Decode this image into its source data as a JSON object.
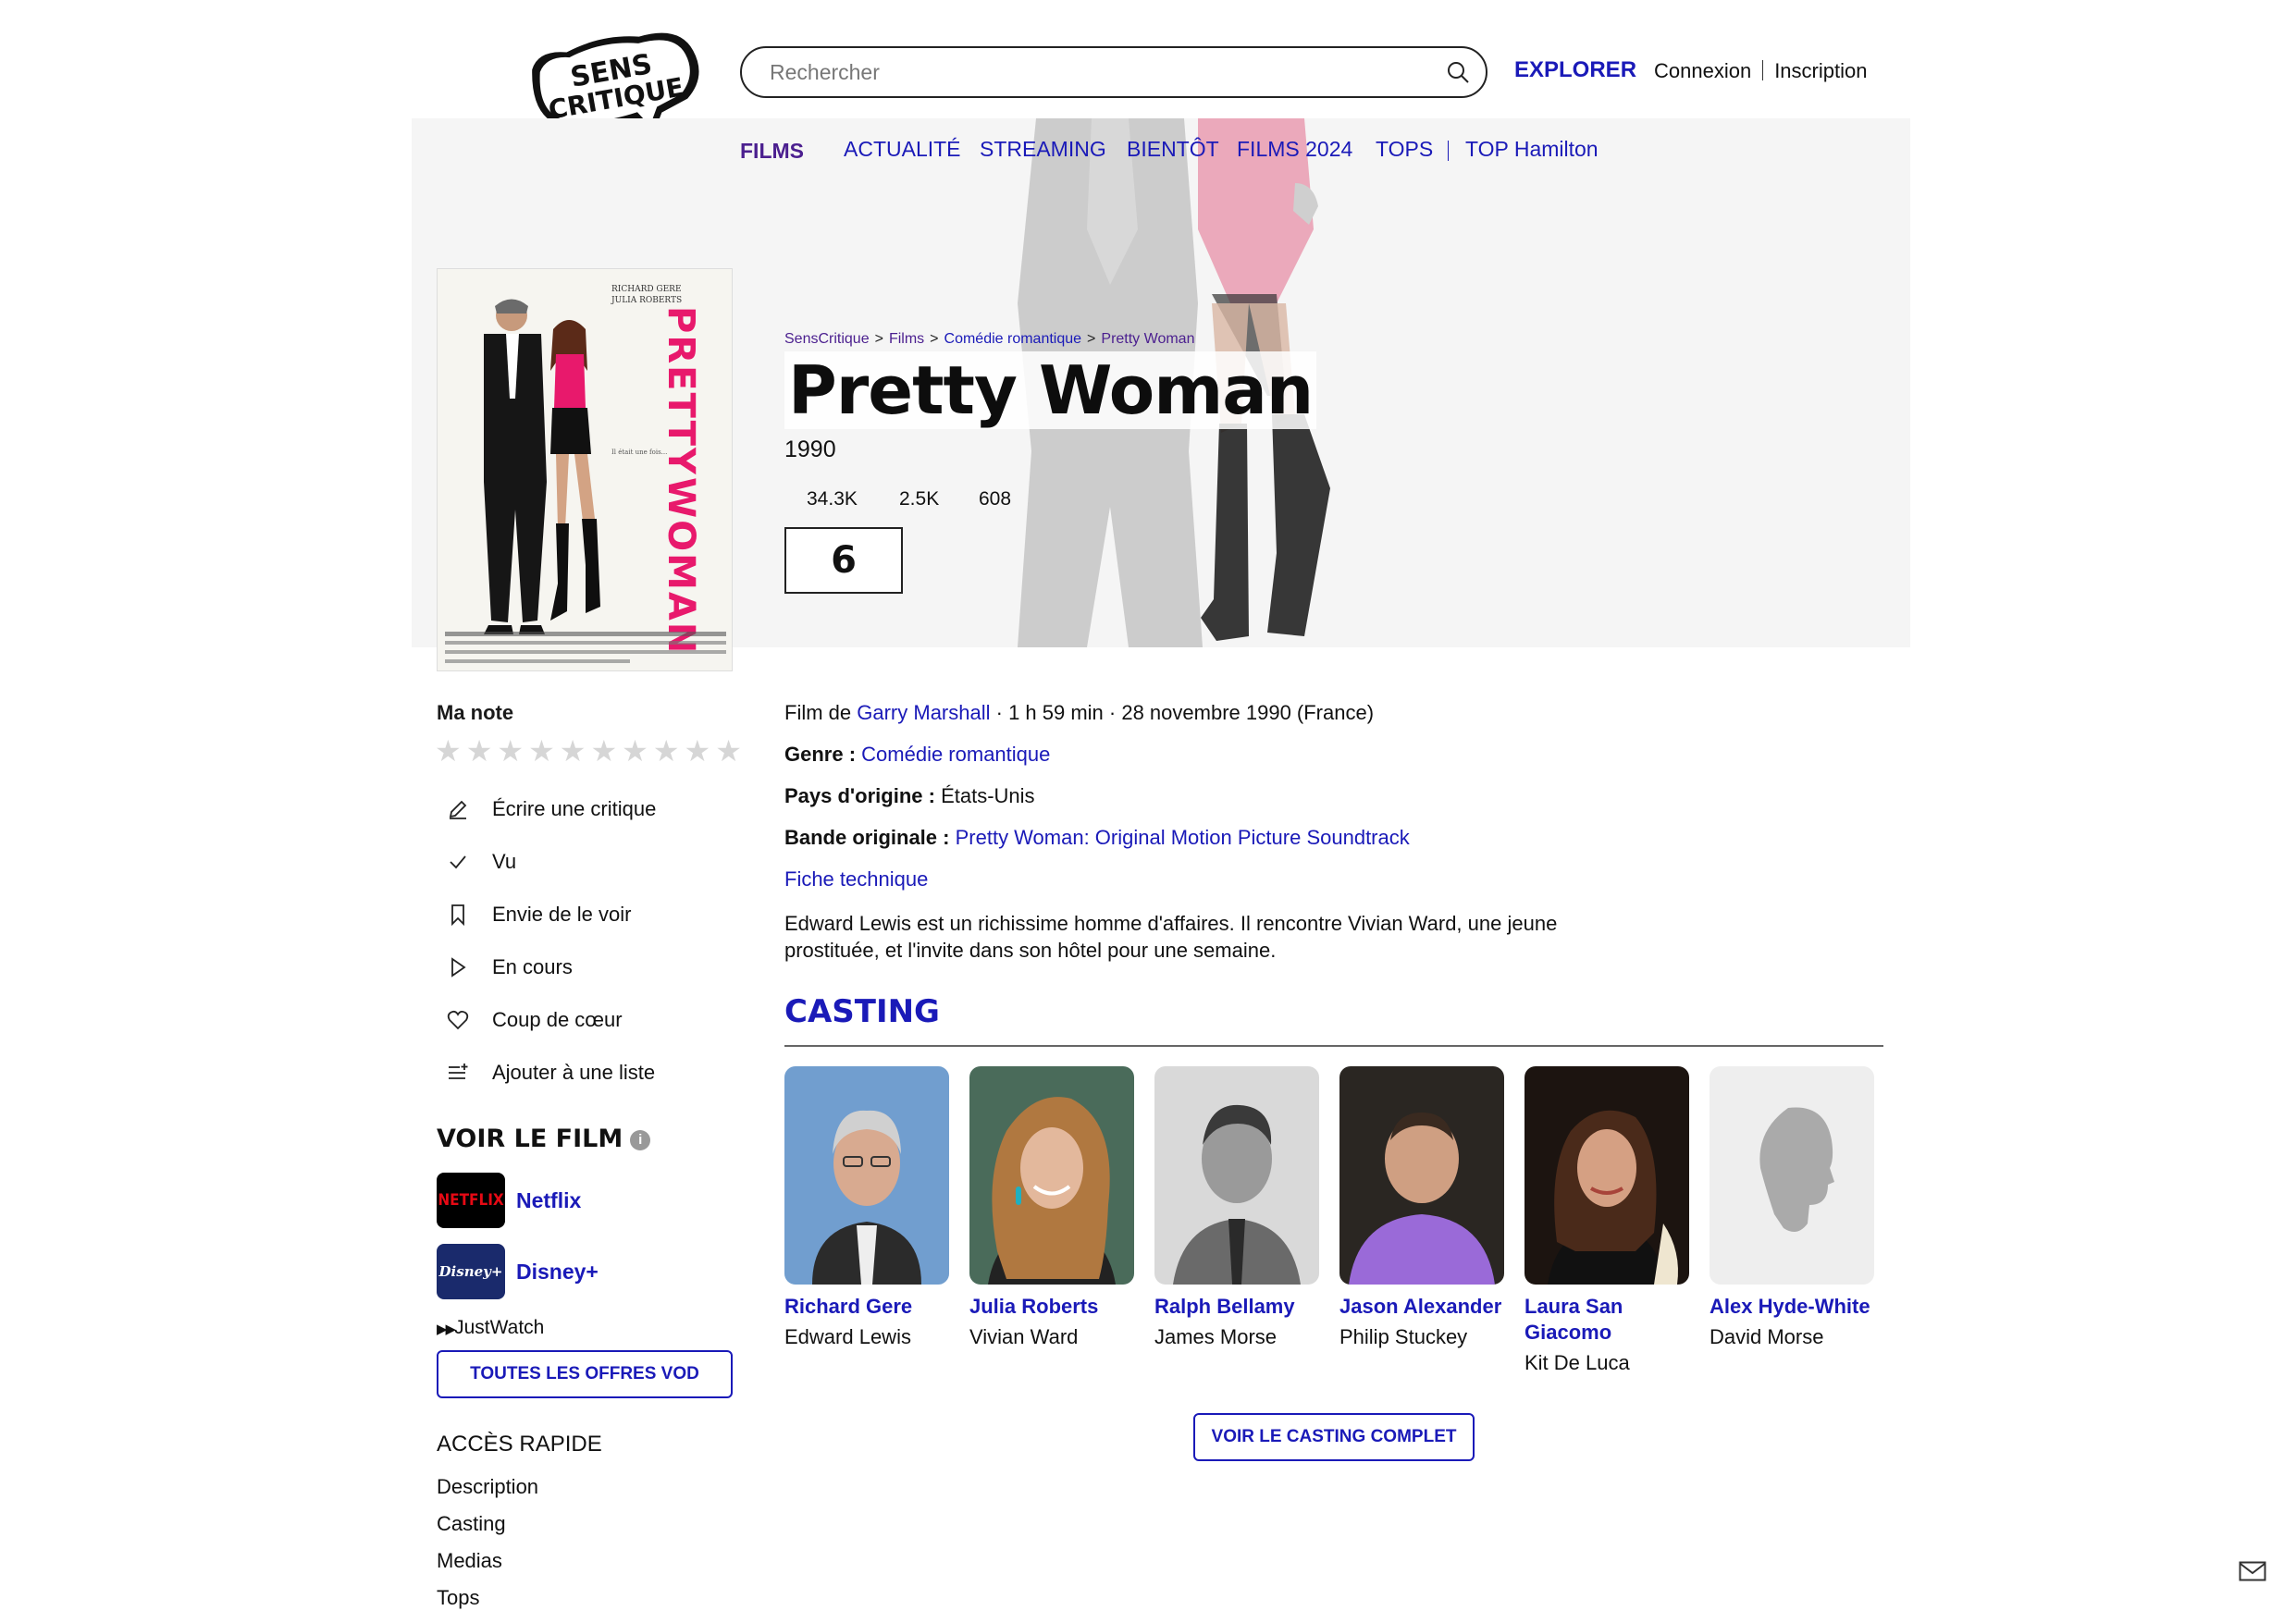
{
  "header": {
    "logo_text": "SENS CRITIQUE",
    "search_placeholder": "Rechercher",
    "explorer_label": "EXPLORER",
    "login_label": "Connexion",
    "signup_label": "Inscription"
  },
  "nav": {
    "section": "FILMS",
    "items": [
      "ACTUALITÉ",
      "STREAMING",
      "BIENTÔT",
      "FILMS 2024",
      "TOPS",
      "TOP Hamilton"
    ]
  },
  "breadcrumb": [
    "SensCritique",
    "Films",
    "Comédie romantique",
    "Pretty Woman"
  ],
  "movie": {
    "title": "Pretty Woman",
    "year": "1990",
    "stats": [
      "34.3K",
      "2.5K",
      "608"
    ],
    "score": "6",
    "poster_text": {
      "actors": "RICHARD GERE\nJULIA ROBERTS",
      "title": "PRETTY WOMAN"
    },
    "director_prefix": "Film de",
    "director": "Garry Marshall",
    "details": "· 1 h 59 min · 28 novembre 1990 (France)",
    "genre_label": "Genre :",
    "genre": "Comédie romantique",
    "country_label": "Pays d'origine :",
    "country": "États-Unis",
    "soundtrack_label": "Bande originale :",
    "soundtrack": "Pretty Woman: Original Motion Picture Soundtrack",
    "tech_link": "Fiche technique",
    "synopsis": "Edward Lewis est un richissime homme d'affaires. Il rencontre Vivian Ward, une jeune prostituée, et l'invite dans son hôtel pour une semaine."
  },
  "sidebar": {
    "my_rating_label": "Ma note",
    "rating_star_count": 10,
    "actions": [
      {
        "icon": "pencil-icon",
        "label": "Écrire une critique"
      },
      {
        "icon": "check-icon",
        "label": "Vu"
      },
      {
        "icon": "bookmark-icon",
        "label": "Envie de le voir"
      },
      {
        "icon": "play-icon",
        "label": "En cours"
      },
      {
        "icon": "heart-icon",
        "label": "Coup de cœur"
      },
      {
        "icon": "add-list-icon",
        "label": "Ajouter à une liste"
      }
    ],
    "watch_title": "VOIR LE FILM",
    "providers": [
      {
        "logo": "NETFLIX",
        "name": "Netflix",
        "color": "#e50914"
      },
      {
        "logo": "Disney+",
        "name": "Disney+",
        "color": "#1a2a6c"
      }
    ],
    "justwatch": "JustWatch",
    "vod_button": "TOUTES LES OFFRES VOD",
    "quick_access_title": "ACCÈS RAPIDE",
    "quick_links": [
      "Description",
      "Casting",
      "Medias",
      "Tops"
    ]
  },
  "casting": {
    "title": "CASTING",
    "members": [
      {
        "name": "Richard Gere",
        "role": "Edward Lewis"
      },
      {
        "name": "Julia Roberts",
        "role": "Vivian Ward"
      },
      {
        "name": "Ralph Bellamy",
        "role": "James Morse"
      },
      {
        "name": "Jason Alexander",
        "role": "Philip Stuckey"
      },
      {
        "name": "Laura San Giacomo",
        "role": "Kit De Luca"
      },
      {
        "name": "Alex Hyde-White",
        "role": "David Morse"
      }
    ],
    "full_button": "VOIR LE CASTING COMPLET"
  },
  "colors": {
    "link": "#1a1ab8",
    "films_purple": "#4b1f8f",
    "hero_bg": "#f5f5f5",
    "poster_pink": "#e8196c"
  }
}
